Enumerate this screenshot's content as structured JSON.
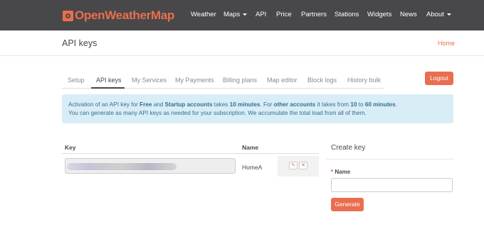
{
  "brand": {
    "name": "OpenWeatherMap",
    "icon": "sun-logo-icon",
    "color": "#eb6e4b"
  },
  "nav": {
    "items": [
      {
        "label": "Weather"
      },
      {
        "label": "Maps",
        "dropdown": true
      },
      {
        "label": "API"
      },
      {
        "label": "Price"
      },
      {
        "label": "Partners"
      },
      {
        "label": "Stations"
      },
      {
        "label": "Widgets"
      },
      {
        "label": "News"
      },
      {
        "label": "About",
        "dropdown": true
      }
    ]
  },
  "header": {
    "title": "API keys",
    "breadcrumb": "Home"
  },
  "tabs": [
    {
      "label": "Setup"
    },
    {
      "label": "API keys",
      "active": true
    },
    {
      "label": "My Services"
    },
    {
      "label": "My Payments"
    },
    {
      "label": "Billing plans"
    },
    {
      "label": "Map editor"
    },
    {
      "label": "Block logs"
    },
    {
      "label": "History bulk"
    }
  ],
  "logout_label": "Logout",
  "alert": {
    "p1": "Activation of an API key for ",
    "b1": "Free",
    "p2": " and ",
    "b2": "Startup accounts",
    "p3": " takes ",
    "b3": "10 minutes",
    "p4": ". For ",
    "b4": "other accounts",
    "p5": " it takes from ",
    "b5": "10",
    "p6": " to ",
    "b6": "60 minutes",
    "p7": ".",
    "line2": "You can generate as many API keys as needed for your subscription. We accumulate the total load from all of them."
  },
  "keys_table": {
    "headers": {
      "key": "Key",
      "name": "Name"
    },
    "rows": [
      {
        "name": "HomeA",
        "edit_icon": "edit-icon",
        "delete_icon": "delete-icon"
      }
    ]
  },
  "create_key": {
    "title": "Create key",
    "name_label": "Name",
    "required_mark": "*",
    "name_value": "",
    "generate_label": "Generate"
  },
  "colors": {
    "navbar": "#48484a",
    "accent": "#e96e50",
    "alert_bg": "#d9edf7",
    "alert_text": "#31708f"
  }
}
